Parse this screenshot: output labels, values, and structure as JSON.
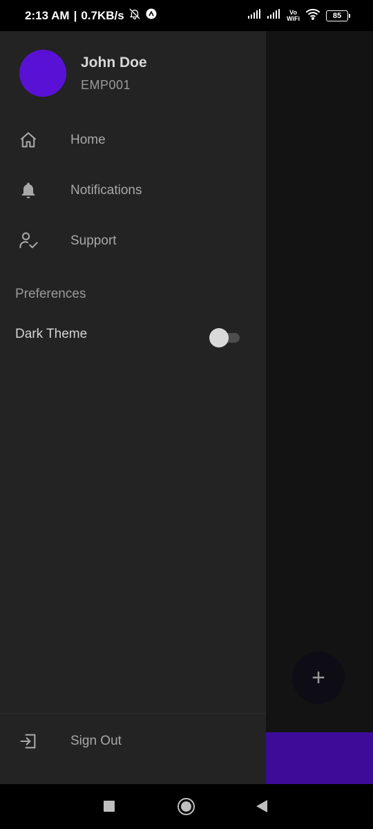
{
  "status_bar": {
    "time": "2:13 AM",
    "separator": "|",
    "network_speed": "0.7KB/s",
    "vowifi_top": "Vo",
    "vowifi_bottom": "WiFi",
    "battery": "85"
  },
  "drawer": {
    "profile": {
      "name": "John Doe",
      "employee_id": "EMP001",
      "avatar_color": "#5a11d6"
    },
    "items": [
      {
        "label": "Home",
        "icon": "home-icon"
      },
      {
        "label": "Notifications",
        "icon": "bell-icon"
      },
      {
        "label": "Support",
        "icon": "user-check-icon"
      }
    ],
    "section_title": "Preferences",
    "dark_theme": {
      "label": "Dark Theme",
      "enabled": false
    },
    "sign_out": {
      "label": "Sign Out",
      "icon": "sign-out-icon"
    }
  },
  "background": {
    "fab_label": "+",
    "accent_color": "#3c0c99"
  }
}
